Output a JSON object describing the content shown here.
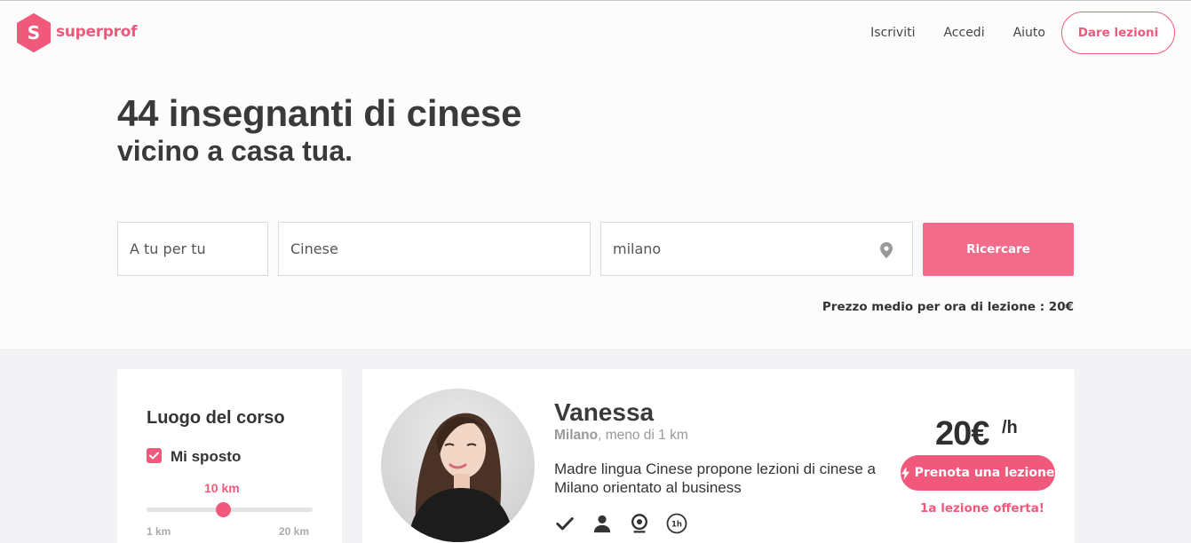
{
  "header": {
    "brand": "superprof",
    "nav": [
      "Iscriviti",
      "Accedi",
      "Aiuto"
    ],
    "cta": "Dare lezioni"
  },
  "hero": {
    "title": "44 insegnanti di cinese",
    "subtitle": "vicino a casa tua."
  },
  "search": {
    "mode_value": "A tu per tu",
    "subject_value": "Cinese",
    "location_value": "milano",
    "button": "Ricercare",
    "average_price": "Prezzo medio per ora di lezione : 20€"
  },
  "filters": {
    "title": "Luogo del corso",
    "checkbox_label": "Mi sposto",
    "checkbox_checked": true,
    "distance_value": "10 km",
    "distance_min": "1 km",
    "distance_max": "20 km",
    "distance_fraction": 0.47
  },
  "tutor": {
    "name": "Vanessa",
    "city": "Milano",
    "distance": ", meno di 1 km",
    "description": "Madre lingua Cinese propone lezioni di cinese a Milano orientato al business",
    "price": "20€",
    "price_unit": "/h",
    "book_button": "Prenota una lezione",
    "offer": "1a lezione offerta!",
    "feature_icons": [
      "check-icon",
      "person-icon",
      "webcam-icon",
      "one-hour-icon"
    ]
  },
  "colors": {
    "brand": "#f0597b",
    "search_button": "#f26b8b"
  }
}
